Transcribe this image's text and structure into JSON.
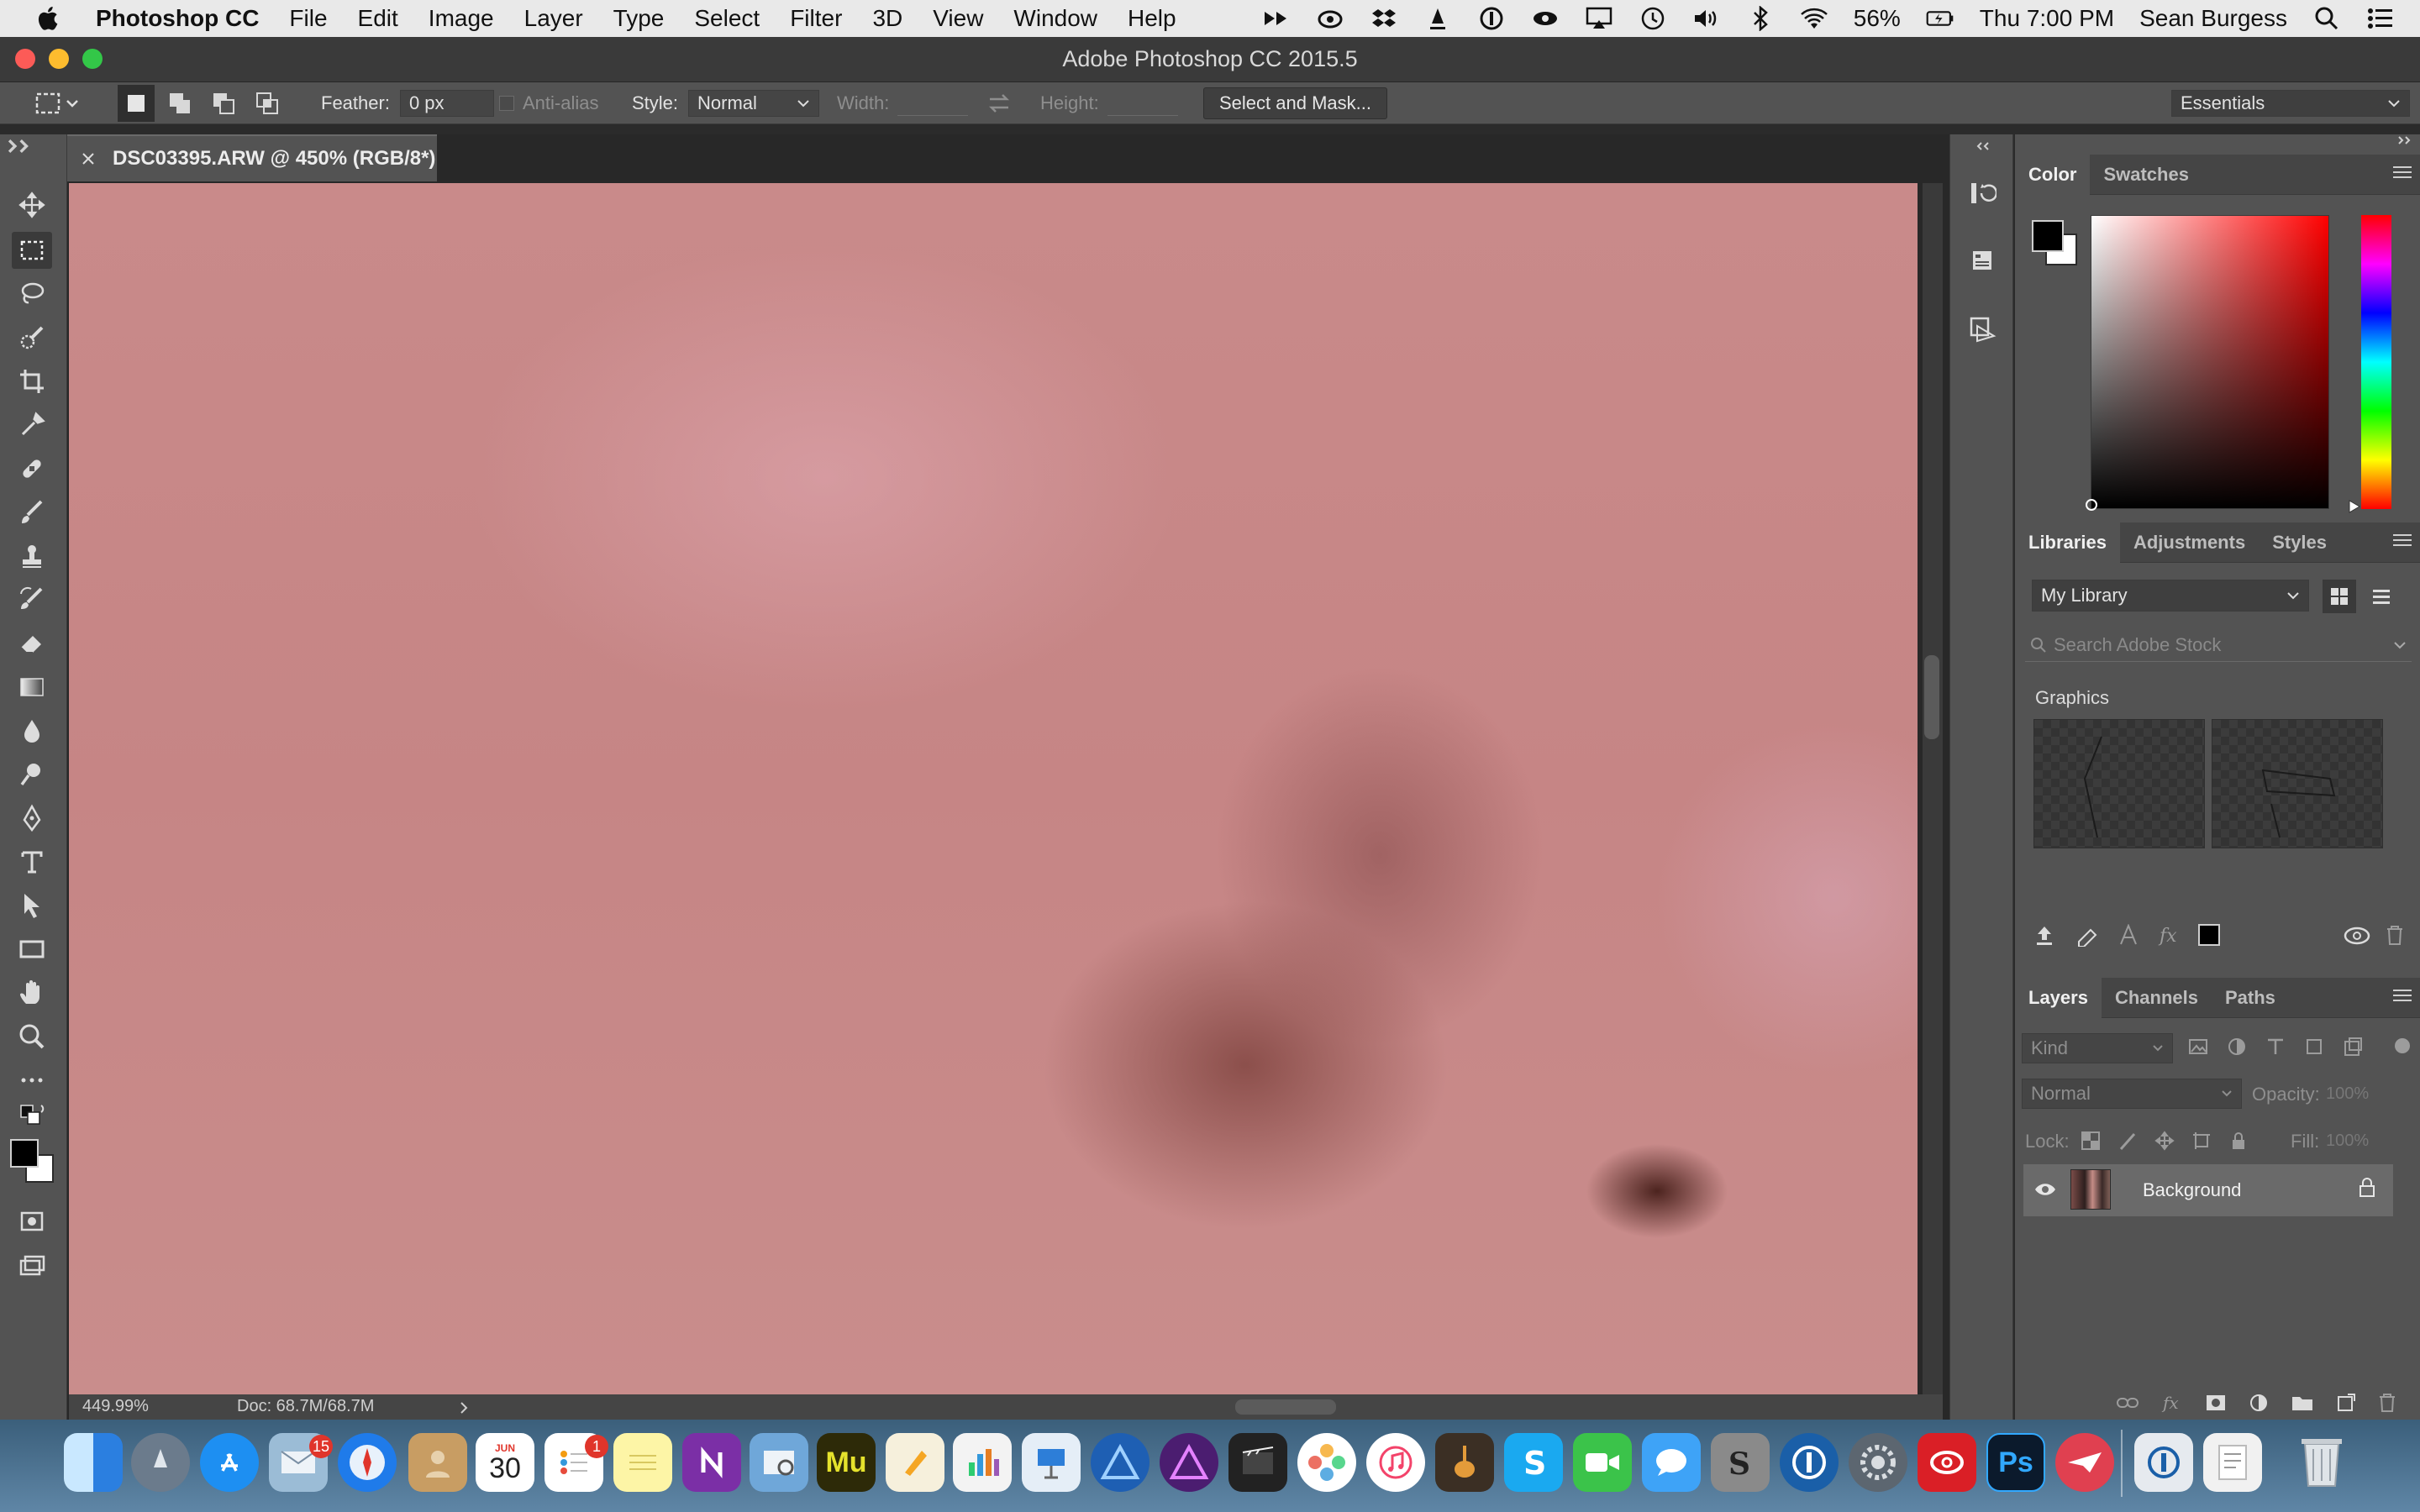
{
  "menubar": {
    "app_name": "Photoshop CC",
    "items": [
      "File",
      "Edit",
      "Image",
      "Layer",
      "Type",
      "Select",
      "Filter",
      "3D",
      "View",
      "Window",
      "Help"
    ],
    "battery": "56%",
    "clock": "Thu 7:00 PM",
    "user": "Sean Burgess"
  },
  "window": {
    "title": "Adobe Photoshop CC 2015.5"
  },
  "options": {
    "feather_label": "Feather:",
    "feather_value": "0 px",
    "antialias_label": "Anti-alias",
    "style_label": "Style:",
    "style_value": "Normal",
    "width_label": "Width:",
    "height_label": "Height:",
    "select_mask_label": "Select and Mask...",
    "workspace": "Essentials"
  },
  "document": {
    "tab_title": "DSC03395.ARW @ 450% (RGB/8*)",
    "zoom": "449.99%",
    "doc_size": "Doc: 68.7M/68.7M"
  },
  "color_panel": {
    "tabs": [
      "Color",
      "Swatches"
    ]
  },
  "libraries_panel": {
    "tabs": [
      "Libraries",
      "Adjustments",
      "Styles"
    ],
    "library": "My Library",
    "search_placeholder": "Search Adobe Stock",
    "section_title": "Graphics"
  },
  "layers_panel": {
    "tabs": [
      "Layers",
      "Channels",
      "Paths"
    ],
    "filter_kind": "Kind",
    "blend_mode": "Normal",
    "opacity_label": "Opacity:",
    "opacity_value": "100%",
    "lock_label": "Lock:",
    "fill_label": "Fill:",
    "fill_value": "100%",
    "layers": [
      {
        "name": "Background"
      }
    ]
  },
  "dock": {
    "calendar_month": "JUN",
    "calendar_day": "30",
    "mail_badge": "15",
    "reminders_badge": "1",
    "muse_label": "Mu",
    "ps_label": "Ps"
  }
}
